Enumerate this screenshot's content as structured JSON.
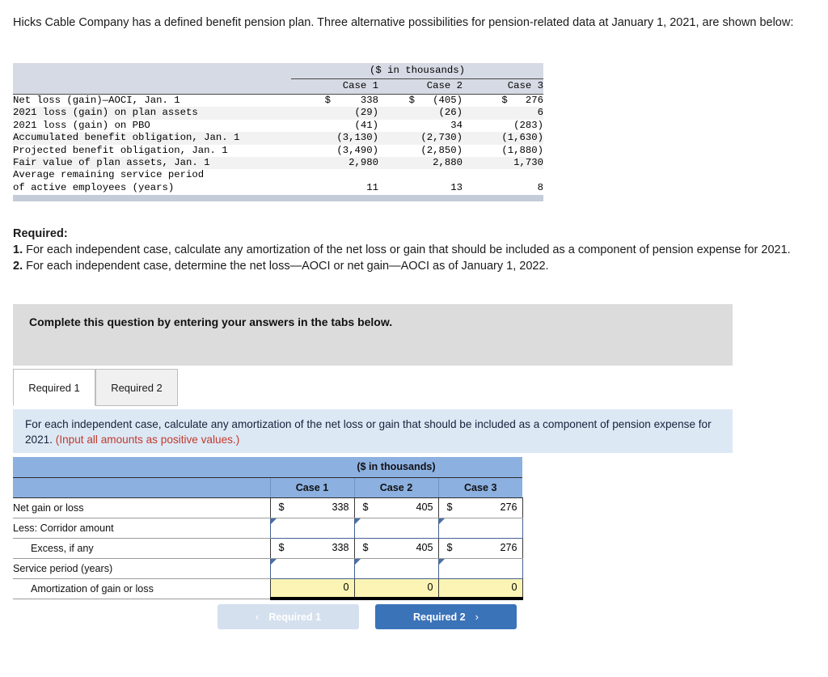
{
  "intro": {
    "text": "Hicks Cable Company has a defined benefit pension plan. Three alternative possibilities for pension-related data at January 1, 2021, are shown below:"
  },
  "data_table": {
    "title": "($ in thousands)",
    "columns": [
      "Case 1",
      "Case 2",
      "Case 3"
    ],
    "rows": [
      {
        "label": "Net loss (gain)—AOCI, Jan. 1",
        "case1": "$     338",
        "case2": "$   (405)",
        "case3": "$   276"
      },
      {
        "label": "2021 loss (gain) on plan assets",
        "case1": "(29)",
        "case2": "(26)",
        "case3": "6"
      },
      {
        "label": "2021 loss (gain) on PBO",
        "case1": "(41)",
        "case2": "34",
        "case3": "(283)"
      },
      {
        "label": "Accumulated benefit obligation, Jan. 1",
        "case1": "(3,130)",
        "case2": "(2,730)",
        "case3": "(1,630)"
      },
      {
        "label": "Projected benefit obligation, Jan. 1",
        "case1": "(3,490)",
        "case2": "(2,850)",
        "case3": "(1,880)"
      },
      {
        "label": "Fair value of plan assets, Jan. 1",
        "case1": "2,980",
        "case2": "2,880",
        "case3": "1,730"
      },
      {
        "label": "Average remaining service period",
        "case1": "",
        "case2": "",
        "case3": ""
      },
      {
        "label": "of active employees (years)",
        "case1": "11",
        "case2": "13",
        "case3": "8"
      }
    ]
  },
  "required": {
    "heading": "Required:",
    "item1_number": "1.",
    "item1_text": " For each independent case, calculate any amortization of the net loss or gain that should be included as a component of pension expense for 2021.",
    "item2_number": "2.",
    "item2_text": " For each independent case, determine the net loss—AOCI or net gain—AOCI as of January 1, 2022."
  },
  "complete_panel": {
    "text": "Complete this question by entering your answers in the tabs below."
  },
  "tabs": [
    {
      "label": "Required 1",
      "active": true
    },
    {
      "label": "Required 2",
      "active": false
    }
  ],
  "instruction": {
    "text": "For each independent case, calculate any amortization of the net loss or gain that should be included as a component of pension expense for 2021. ",
    "note": "(Input all amounts as positive values.)"
  },
  "answer_table": {
    "title": "($ in thousands)",
    "columns": [
      "Case 1",
      "Case 2",
      "Case 3"
    ],
    "rows": [
      {
        "label": "Net gain or loss",
        "indent": false,
        "type": "value",
        "cells": [
          {
            "currency": "$",
            "amount": "338"
          },
          {
            "currency": "$",
            "amount": "405"
          },
          {
            "currency": "$",
            "amount": "276"
          }
        ]
      },
      {
        "label": "Less: Corridor amount",
        "indent": false,
        "type": "input",
        "cells": [
          {
            "currency": "",
            "amount": ""
          },
          {
            "currency": "",
            "amount": ""
          },
          {
            "currency": "",
            "amount": ""
          }
        ]
      },
      {
        "label": "Excess, if any",
        "indent": true,
        "type": "value",
        "cells": [
          {
            "currency": "$",
            "amount": "338"
          },
          {
            "currency": "$",
            "amount": "405"
          },
          {
            "currency": "$",
            "amount": "276"
          }
        ]
      },
      {
        "label": "Service period (years)",
        "indent": false,
        "type": "input",
        "cells": [
          {
            "currency": "",
            "amount": ""
          },
          {
            "currency": "",
            "amount": ""
          },
          {
            "currency": "",
            "amount": ""
          }
        ]
      },
      {
        "label": "Amortization of gain or loss",
        "indent": true,
        "type": "result",
        "cells": [
          {
            "currency": "",
            "amount": "0"
          },
          {
            "currency": "",
            "amount": "0"
          },
          {
            "currency": "",
            "amount": "0"
          }
        ]
      }
    ]
  },
  "nav": {
    "prev_label": "Required 1",
    "prev_icon": "chevron-left-icon",
    "prev_chevron": "‹",
    "next_label": "Required 2",
    "next_icon": "chevron-right-icon",
    "next_chevron": "›"
  },
  "colors": {
    "header_blue": "#8cb0e0",
    "banner_blue": "#dde8f5",
    "panel_gray": "#dcdcdc",
    "result_yellow": "#fbf4b4",
    "button_blue": "#3b73b9",
    "button_disabled": "#d4e0ee",
    "note_red": "#c0392b",
    "data_header_gray": "#d6dae4"
  }
}
